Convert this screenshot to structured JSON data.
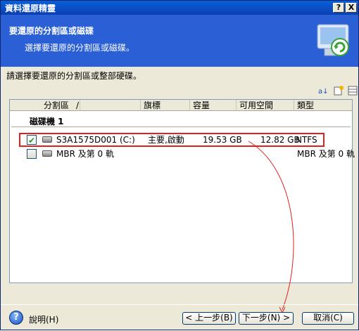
{
  "window": {
    "title": "資料還原精靈",
    "help_btn": "?",
    "close_btn": "X"
  },
  "header": {
    "title": "要還原的分割區或磁碟",
    "subtitle": "選擇要還原的分割區或磁碟。"
  },
  "instruction": "請選擇要還原的分割區或整部硬碟。",
  "columns": [
    "分割區",
    "/",
    "旗標",
    "容量",
    "可用空間",
    "類型"
  ],
  "group": "磁碟機 1",
  "rows": [
    {
      "checked": true,
      "name": "S3A1575D001 (C:)",
      "flags": "主要,啟動",
      "capacity": "19.53 GB",
      "free": "12.82 GB",
      "type": "NTFS"
    },
    {
      "checked": false,
      "name": "MBR 及第 0 軌",
      "flags": "",
      "capacity": "",
      "free": "",
      "type": "MBR 及第 0 軌"
    }
  ],
  "footer": {
    "help": "說明(H)",
    "back": "< 上一步(B)",
    "next": "下一步(N) >",
    "cancel": "取消(C)"
  },
  "colors": {
    "header_bg": "#2b5fd5",
    "highlight": "#e0221f",
    "window_bg": "#ece9d8"
  }
}
